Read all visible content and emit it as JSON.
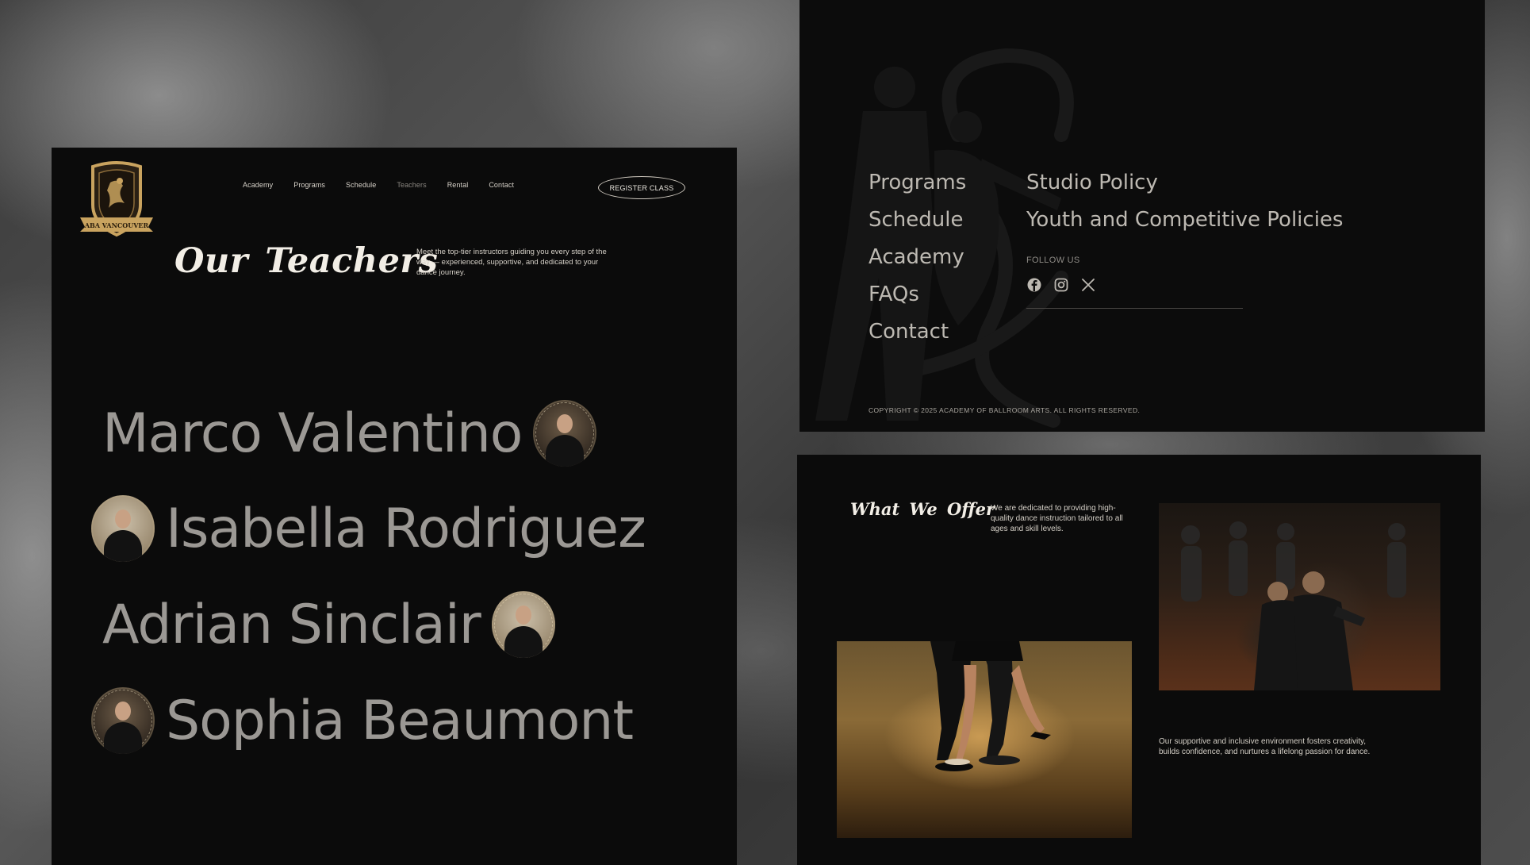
{
  "teachers_page": {
    "crest_text": "ABA VANCOUVER",
    "nav": [
      "Academy",
      "Programs",
      "Schedule",
      "Teachers",
      "Rental",
      "Contact"
    ],
    "active_nav": "Teachers",
    "register_label": "REGISTER CLASS",
    "title": "Our Teachers",
    "description": "Meet the top-tier instructors guiding you every step of the way — experienced, supportive, and dedicated to your dance journey.",
    "teachers": [
      "Marco Valentino",
      "Isabella Rodriguez",
      "Adrian Sinclair",
      "Sophia Beaumont"
    ]
  },
  "footer": {
    "links_col1": [
      "Programs",
      "Schedule",
      "Academy",
      "FAQs",
      "Contact"
    ],
    "links_col2": [
      "Studio Policy",
      "Youth and Competitive Policies"
    ],
    "follow_label": "FOLLOW US",
    "socials": [
      "facebook-icon",
      "instagram-icon",
      "x-icon"
    ],
    "copyright": "COPYRIGHT © 2025 ACADEMY OF BALLROOM ARTS. ALL RIGHTS RESERVED."
  },
  "offer": {
    "title": "What We Offer",
    "description": "We are dedicated to providing high-quality dance instruction tailored to all ages and skill levels.",
    "description2": "Our supportive and inclusive environment fosters creativity, builds confidence, and nurtures a lifelong passion for dance."
  },
  "colors": {
    "panel_bg": "#0b0b0b",
    "teacher_name": "#9b9894",
    "crest_gold": "#c9a35f"
  }
}
